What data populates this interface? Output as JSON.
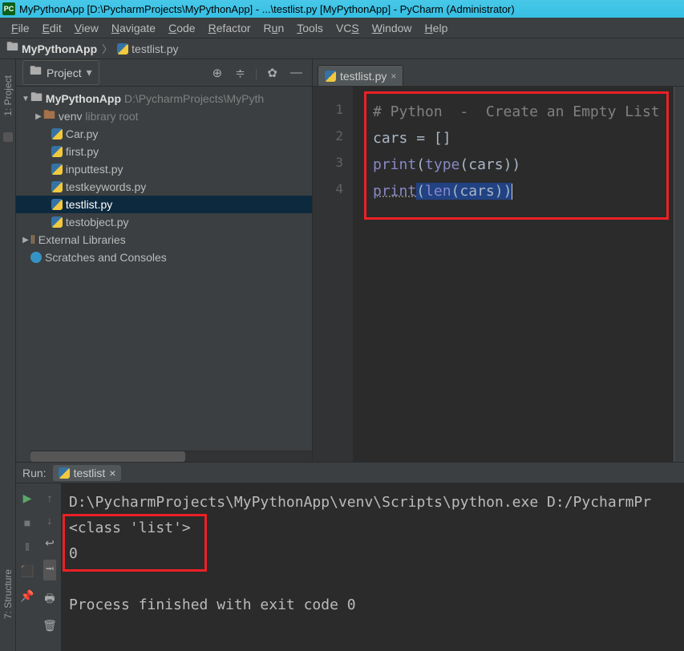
{
  "title": "MyPythonApp [D:\\PycharmProjects\\MyPythonApp] - ...\\testlist.py [MyPythonApp] - PyCharm (Administrator)",
  "app_icon_text": "PC",
  "menu": [
    "File",
    "Edit",
    "View",
    "Navigate",
    "Code",
    "Refactor",
    "Run",
    "Tools",
    "VCS",
    "Window",
    "Help"
  ],
  "breadcrumb": {
    "project": "MyPythonApp",
    "file": "testlist.py"
  },
  "side_tabs": {
    "project": "1: Project",
    "structure": "7: Structure"
  },
  "project_panel": {
    "title": "Project",
    "root": {
      "name": "MyPythonApp",
      "path": "D:\\PycharmProjects\\MyPyth"
    },
    "venv": {
      "name": "venv",
      "tag": "library root"
    },
    "files": [
      "Car.py",
      "first.py",
      "inputtest.py",
      "testkeywords.py",
      "testlist.py",
      "testobject.py"
    ],
    "external": "External Libraries",
    "scratches": "Scratches and Consoles"
  },
  "editor": {
    "tab": "testlist.py",
    "lines": [
      "1",
      "2",
      "3",
      "4"
    ],
    "code": {
      "l1": "# Python  -  Create an Empty List",
      "l2_lhs": "cars ",
      "l2_eq": "= ",
      "l2_rhs": "[]",
      "l3_print": "print",
      "l3_type": "type",
      "l3_var": "cars",
      "l4_print": "print",
      "l4_len": "len",
      "l4_var": "cars"
    }
  },
  "run": {
    "label": "Run:",
    "tab": "testlist",
    "out_cmd": "D:\\PycharmProjects\\MyPythonApp\\venv\\Scripts\\python.exe D:/PycharmPr",
    "out_class": "<class 'list'>",
    "out_zero": "0",
    "out_done": "Process finished with exit code 0"
  }
}
